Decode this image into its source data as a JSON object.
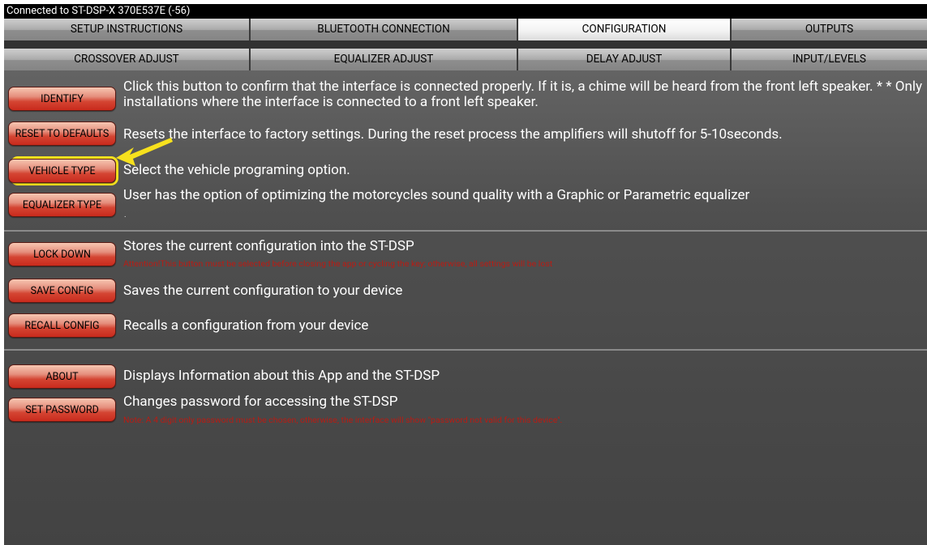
{
  "status_bar": {
    "text": "Connected to ST-DSP-X  370E537E (-56)"
  },
  "tabs_row1": [
    "SETUP INSTRUCTIONS",
    "BLUETOOTH CONNECTION",
    "CONFIGURATION",
    "OUTPUTS"
  ],
  "tabs_row2": [
    "CROSSOVER ADJUST",
    "EQUALIZER ADJUST",
    "DELAY ADJUST",
    "INPUT/LEVELS"
  ],
  "active_tab": "CONFIGURATION",
  "config": {
    "identify": {
      "label": "IDENTIFY",
      "desc": "Click this button to confirm that the interface is connected properly. If it is, a chime will be heard from the front left speaker. * * Only installations where the interface is connected to a front left speaker."
    },
    "reset": {
      "label": "RESET TO DEFAULTS",
      "desc": "Resets the interface to factory settings. During the reset process the amplifiers will shutoff for 5-10seconds."
    },
    "vehicle": {
      "label": "VEHICLE TYPE",
      "desc": "Select the vehicle programing option."
    },
    "equalizer": {
      "label": "EQUALIZER TYPE",
      "desc": "User has the option of optimizing the motorcycles sound quality with a Graphic or Parametric equalizer",
      "trailing": "."
    },
    "lockdown": {
      "label": "LOCK DOWN",
      "desc": "Stores the current configuration into the ST-DSP",
      "warning": "Attention!This button must be selected before closing the app or cycling the key; otherwise, all settings will be lost"
    },
    "save": {
      "label": "SAVE CONFIG",
      "desc": "Saves the current configuration to your device"
    },
    "recall": {
      "label": "RECALL CONFIG",
      "desc": "Recalls a configuration from your device"
    },
    "about": {
      "label": "ABOUT",
      "desc": "Displays Information about this App and the ST-DSP"
    },
    "password": {
      "label": "SET PASSWORD",
      "desc": "Changes password for accessing the ST-DSP",
      "note": "Note: A 4 digit only password must be chosen, otherwise, the interface will show \"password not valid for this device\"."
    }
  },
  "colors": {
    "highlight": "#f7e11d",
    "button_red": "#d44533",
    "warning_red": "#b81c14"
  }
}
